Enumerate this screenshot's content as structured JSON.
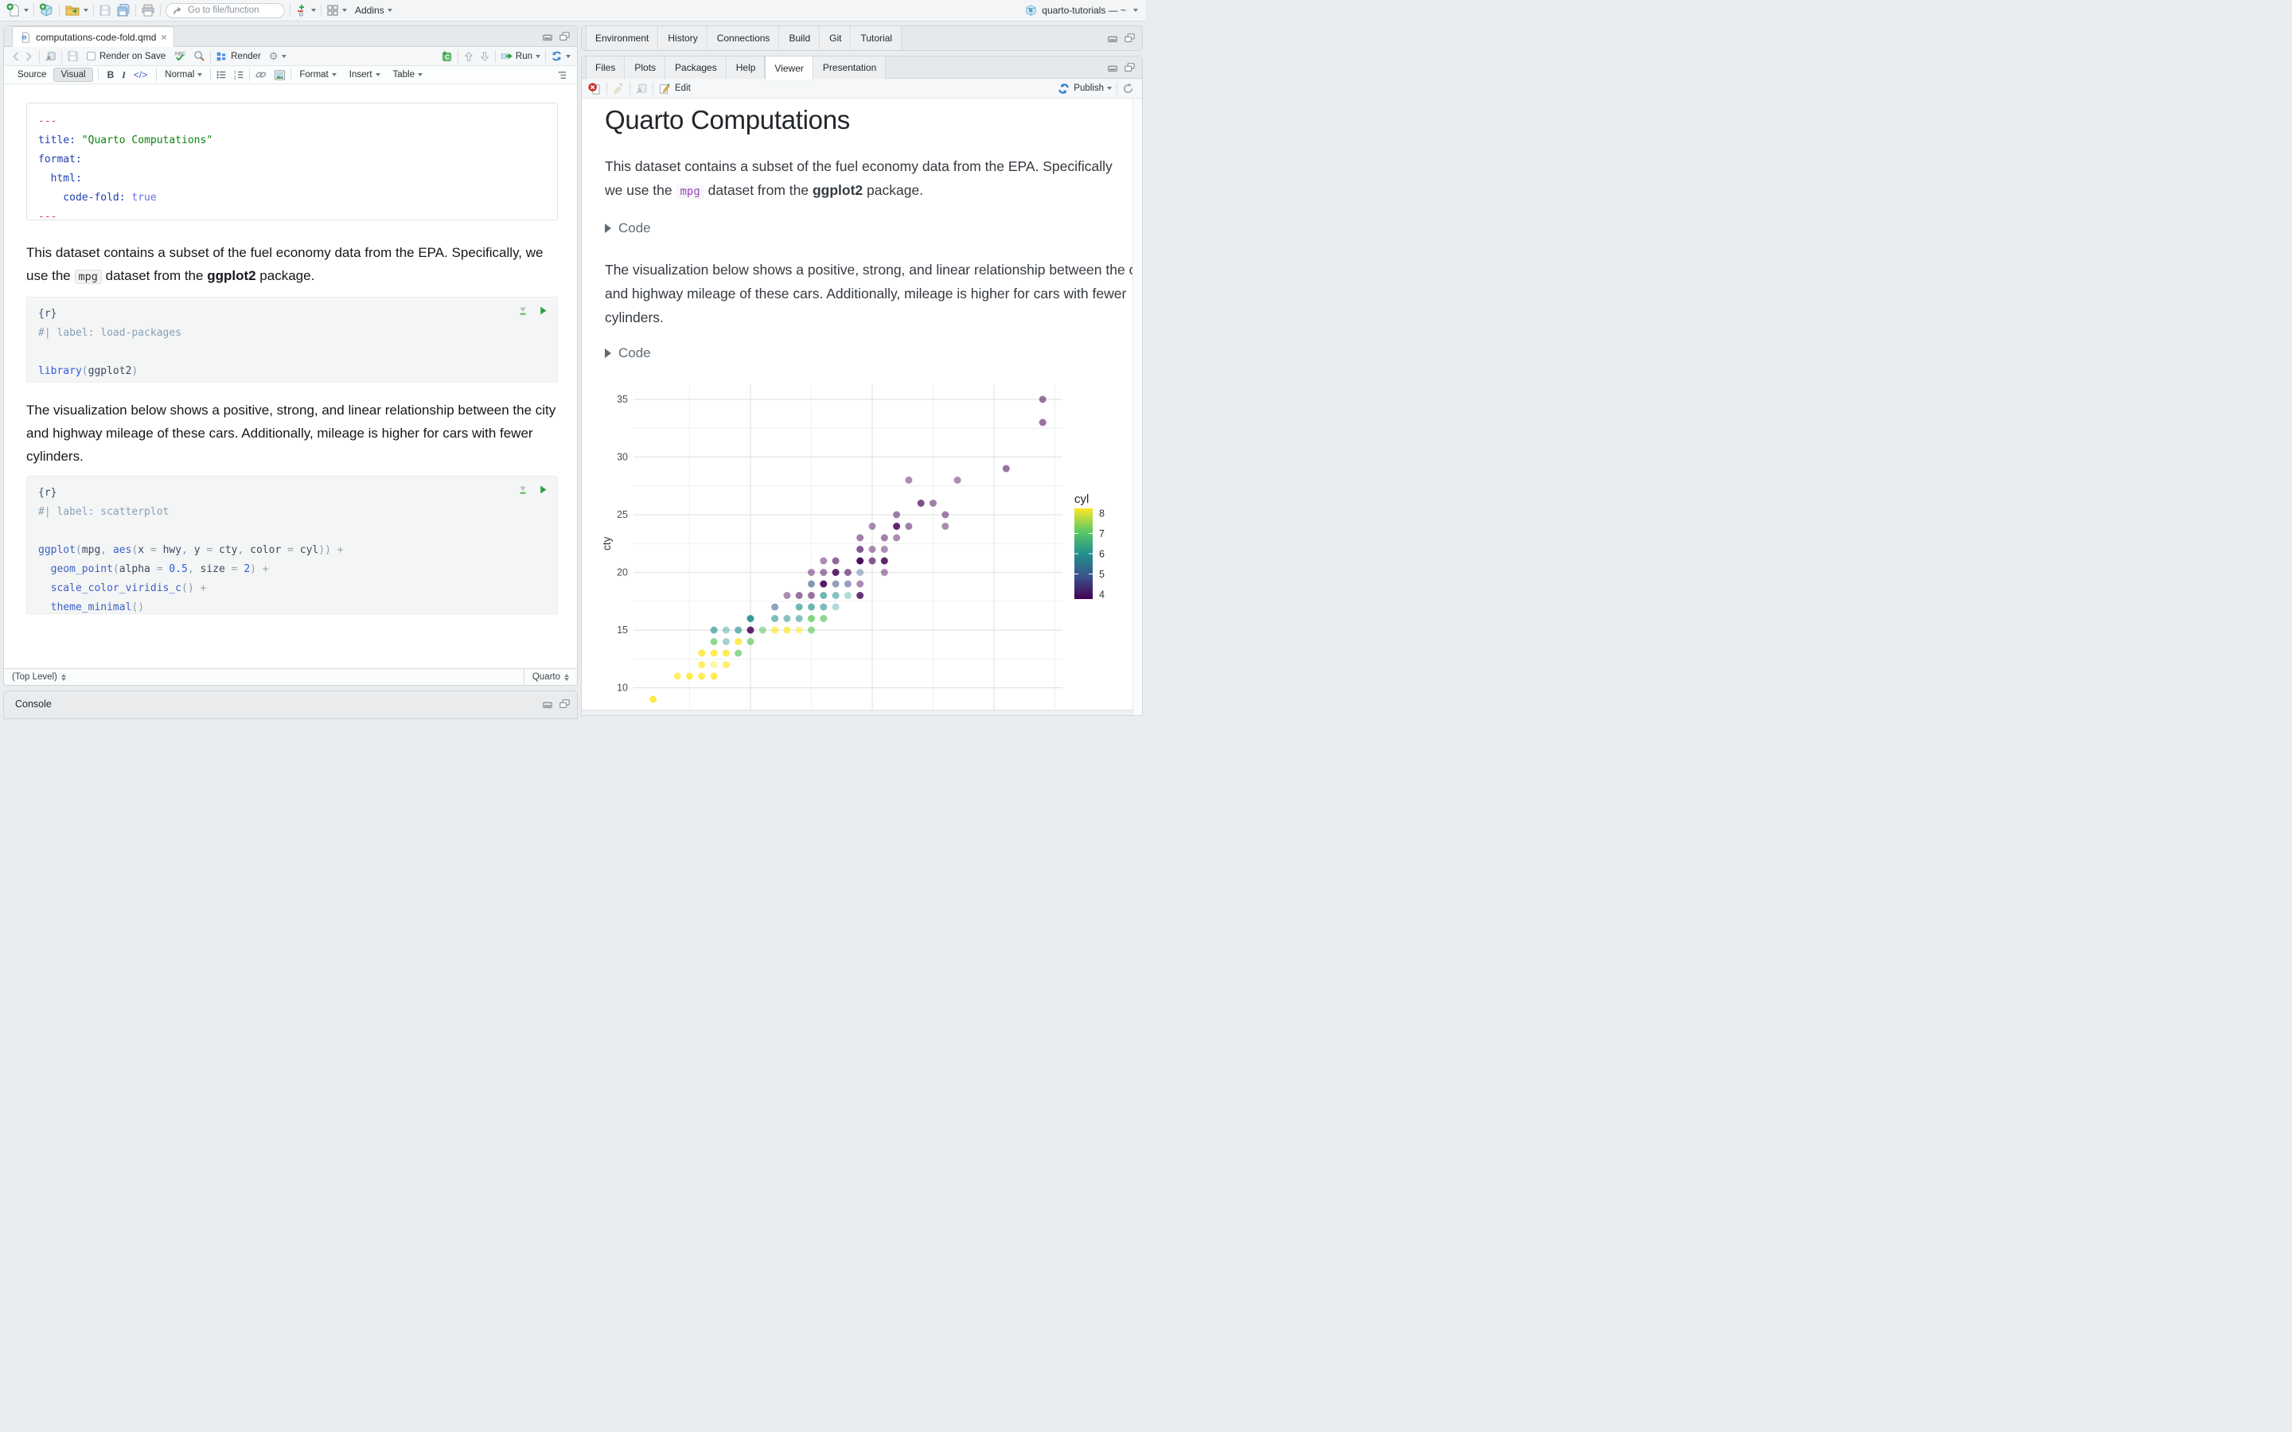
{
  "icons": {
    "caret": "▾",
    "gear": "⚙",
    "close": "×",
    "bold": "B",
    "italic": "I",
    "code_tag": "</>"
  },
  "main_toolbar": {
    "goto_placeholder": "Go to file/function",
    "addins_label": "Addins",
    "project_label": "quarto-tutorials — ~"
  },
  "editor": {
    "filename": "computations-code-fold.qmd",
    "toolbar": {
      "render_on_save": "Render on Save",
      "render": "Render",
      "run": "Run"
    },
    "format_bar": {
      "source": "Source",
      "visual": "Visual",
      "paragraph_style": "Normal",
      "format": "Format",
      "insert": "Insert",
      "table": "Table"
    },
    "status": {
      "scope": "(Top Level)",
      "mode": "Quarto"
    },
    "yaml": [
      [
        [
          "---",
          "pink"
        ]
      ],
      [
        [
          "title:",
          "key"
        ],
        [
          " ",
          ""
        ],
        [
          "\"Quarto Computations\"",
          "str"
        ]
      ],
      [
        [
          "format:",
          "key"
        ]
      ],
      [
        [
          "  html:",
          "key"
        ]
      ],
      [
        [
          "    code-fold:",
          "key"
        ],
        [
          " ",
          ""
        ],
        [
          "true",
          "bool"
        ]
      ],
      [
        [
          "---",
          "pink"
        ]
      ]
    ],
    "para1": [
      {
        "t": "This dataset contains a subset of the fuel economy data from the EPA. Specifically, we use the "
      },
      {
        "t": "mpg",
        "style": "code"
      },
      {
        "t": " dataset from the "
      },
      {
        "t": "ggplot2",
        "style": "bold"
      },
      {
        "t": " package."
      }
    ],
    "chunk1": [
      [
        [
          "{r}",
          "hdr"
        ]
      ],
      [
        [
          "#| label: load-packages",
          "cmt"
        ]
      ],
      [
        [
          "",
          ""
        ]
      ],
      [
        [
          "library",
          "fn2"
        ],
        [
          "(",
          "par"
        ],
        [
          "ggplot2",
          "drk"
        ],
        [
          ")",
          "par"
        ]
      ]
    ],
    "para2": "The visualization below shows a positive, strong, and linear relationship between the city and highway mileage of these cars. Additionally, mileage is higher for cars with fewer cylinders.",
    "chunk2": [
      [
        [
          "{r}",
          "hdr"
        ]
      ],
      [
        [
          "#| label: scatterplot",
          "cmt"
        ]
      ],
      [
        [
          "",
          ""
        ]
      ],
      [
        [
          "ggplot",
          "fn"
        ],
        [
          "(",
          "par"
        ],
        [
          "mpg",
          "drk"
        ],
        [
          ", ",
          "par"
        ],
        [
          "aes",
          "fn"
        ],
        [
          "(",
          "par"
        ],
        [
          "x ",
          "drk"
        ],
        [
          "= ",
          "op"
        ],
        [
          "hwy",
          "drk"
        ],
        [
          ", ",
          "par"
        ],
        [
          "y ",
          "drk"
        ],
        [
          "= ",
          "op"
        ],
        [
          "cty",
          "drk"
        ],
        [
          ", ",
          "par"
        ],
        [
          "color ",
          "drk"
        ],
        [
          "= ",
          "op"
        ],
        [
          "cyl",
          "drk"
        ],
        [
          "))",
          "par"
        ],
        [
          " +",
          "op"
        ]
      ],
      [
        [
          "  geom_point",
          "fn"
        ],
        [
          "(",
          "par"
        ],
        [
          "alpha ",
          "drk"
        ],
        [
          "= ",
          "op"
        ],
        [
          "0.5",
          "num"
        ],
        [
          ", ",
          "par"
        ],
        [
          "size ",
          "drk"
        ],
        [
          "= ",
          "op"
        ],
        [
          "2",
          "num"
        ],
        [
          ")",
          "par"
        ],
        [
          " +",
          "op"
        ]
      ],
      [
        [
          "  scale_color_viridis_c",
          "fn"
        ],
        [
          "()",
          "par"
        ],
        [
          " +",
          "op"
        ]
      ],
      [
        [
          "  theme_minimal",
          "fn"
        ],
        [
          "()",
          "par"
        ]
      ]
    ]
  },
  "console": {
    "title": "Console"
  },
  "right_top_tabs": [
    "Environment",
    "History",
    "Connections",
    "Build",
    "Git",
    "Tutorial"
  ],
  "right_bottom_tabs": [
    "Files",
    "Plots",
    "Packages",
    "Help",
    "Viewer",
    "Presentation"
  ],
  "active_bottom_tab_index": 4,
  "viewer": {
    "edit_label": "Edit",
    "publish_label": "Publish",
    "doc": {
      "title": "Quarto Computations",
      "para1": [
        {
          "t": "This dataset contains a subset of the fuel economy data from the EPA. Specifically we use the "
        },
        {
          "t": "mpg",
          "style": "code"
        },
        {
          "t": " dataset from the "
        },
        {
          "t": "ggplot2",
          "style": "bold"
        },
        {
          "t": " package."
        }
      ],
      "code_toggle": "Code",
      "para2": "The visualization below shows a positive, strong, and linear relationship between the city and highway mileage of these cars. Additionally, mileage is higher for cars with fewer cylinders."
    }
  },
  "chart_data": {
    "type": "scatter",
    "title": "",
    "xlabel": "",
    "ylabel": "cty",
    "x_field": "hwy",
    "color_field": "cyl",
    "x_axis_labels_visible": false,
    "xlim_visible": [
      10.4,
      45.6
    ],
    "ylim_visible": [
      8.3,
      36.3
    ],
    "y_ticks": [
      10,
      15,
      20,
      25,
      30,
      35
    ],
    "x_gridlines_major": [
      20,
      30,
      40
    ],
    "x_gridlines_minor": [
      15,
      25,
      35,
      45
    ],
    "y_gridlines_minor": [
      12.5,
      17.5,
      22.5,
      27.5,
      32.5
    ],
    "alpha": 0.5,
    "point_size": 2,
    "legend": {
      "title": "cyl",
      "position": "right",
      "ticks": [
        8,
        7,
        6,
        5,
        4
      ],
      "colors": {
        "4": "#440154",
        "5": "#3b528b",
        "6": "#21918c",
        "7": "#5ec962",
        "8": "#fde725"
      }
    },
    "points": [
      [
        44,
        35,
        4,
        0.55
      ],
      [
        44,
        33,
        4,
        0.55
      ],
      [
        41,
        29,
        4,
        0.55
      ],
      [
        33,
        28,
        4,
        0.45
      ],
      [
        37,
        28,
        4,
        0.45
      ],
      [
        34,
        26,
        4,
        0.7
      ],
      [
        35,
        26,
        4,
        0.5
      ],
      [
        32,
        25,
        4,
        0.5
      ],
      [
        36,
        25,
        4,
        0.5
      ],
      [
        30,
        24,
        4,
        0.45
      ],
      [
        32,
        24,
        4,
        0.85
      ],
      [
        33,
        24,
        4,
        0.5
      ],
      [
        36,
        24,
        4,
        0.45
      ],
      [
        29,
        23,
        4,
        0.5
      ],
      [
        31,
        23,
        4,
        0.5
      ],
      [
        32,
        23,
        4,
        0.45
      ],
      [
        29,
        22,
        4,
        0.65
      ],
      [
        30,
        22,
        4,
        0.45
      ],
      [
        31,
        22,
        4,
        0.45
      ],
      [
        26,
        21,
        4,
        0.45
      ],
      [
        27,
        21,
        4,
        0.6
      ],
      [
        29,
        21,
        4,
        0.95
      ],
      [
        30,
        21,
        4,
        0.65
      ],
      [
        31,
        21,
        4,
        0.85
      ],
      [
        25,
        20,
        4,
        0.45
      ],
      [
        26,
        20,
        4,
        0.5
      ],
      [
        27,
        20,
        4,
        0.85
      ],
      [
        28,
        20,
        4,
        0.6
      ],
      [
        29,
        20,
        5,
        0.4
      ],
      [
        31,
        20,
        4,
        0.45
      ],
      [
        25,
        19,
        5,
        0.6
      ],
      [
        26,
        19,
        4,
        0.9
      ],
      [
        27,
        19,
        5,
        0.55
      ],
      [
        28,
        19,
        5,
        0.55
      ],
      [
        29,
        19,
        4,
        0.45
      ],
      [
        23,
        18,
        4,
        0.45
      ],
      [
        24,
        18,
        4,
        0.55
      ],
      [
        25,
        18,
        4,
        0.55
      ],
      [
        26,
        18,
        6,
        0.65
      ],
      [
        27,
        18,
        6,
        0.55
      ],
      [
        28,
        18,
        6,
        0.35
      ],
      [
        29,
        18,
        4,
        0.8
      ],
      [
        22,
        17,
        5,
        0.55
      ],
      [
        24,
        17,
        6,
        0.65
      ],
      [
        25,
        17,
        6,
        0.65
      ],
      [
        26,
        17,
        6,
        0.6
      ],
      [
        27,
        17,
        6,
        0.35
      ],
      [
        20,
        16,
        6,
        0.9
      ],
      [
        22,
        16,
        6,
        0.6
      ],
      [
        23,
        16,
        6,
        0.55
      ],
      [
        24,
        16,
        6,
        0.55
      ],
      [
        25,
        16,
        7,
        0.8
      ],
      [
        26,
        16,
        7,
        0.7
      ],
      [
        17,
        15,
        6,
        0.65
      ],
      [
        18,
        15,
        6,
        0.4
      ],
      [
        19,
        15,
        6,
        0.65
      ],
      [
        20,
        15,
        4,
        0.85
      ],
      [
        21,
        15,
        7,
        0.6
      ],
      [
        22,
        15,
        8,
        0.7
      ],
      [
        23,
        15,
        8,
        0.7
      ],
      [
        24,
        15,
        8,
        0.55
      ],
      [
        25,
        15,
        7,
        0.65
      ],
      [
        17,
        14,
        7,
        0.7
      ],
      [
        18,
        14,
        6,
        0.4
      ],
      [
        19,
        14,
        8,
        0.8
      ],
      [
        20,
        14,
        7,
        0.7
      ],
      [
        16,
        13,
        8,
        0.8
      ],
      [
        17,
        13,
        8,
        0.8
      ],
      [
        18,
        13,
        8,
        0.8
      ],
      [
        19,
        13,
        7,
        0.7
      ],
      [
        16,
        12,
        8,
        0.7
      ],
      [
        17,
        12,
        8,
        0.4
      ],
      [
        18,
        12,
        8,
        0.7
      ],
      [
        14,
        11,
        8,
        0.7
      ],
      [
        15,
        11,
        8,
        0.8
      ],
      [
        16,
        11,
        8,
        0.8
      ],
      [
        17,
        11,
        8,
        0.8
      ],
      [
        12,
        9,
        8,
        0.85
      ]
    ]
  }
}
